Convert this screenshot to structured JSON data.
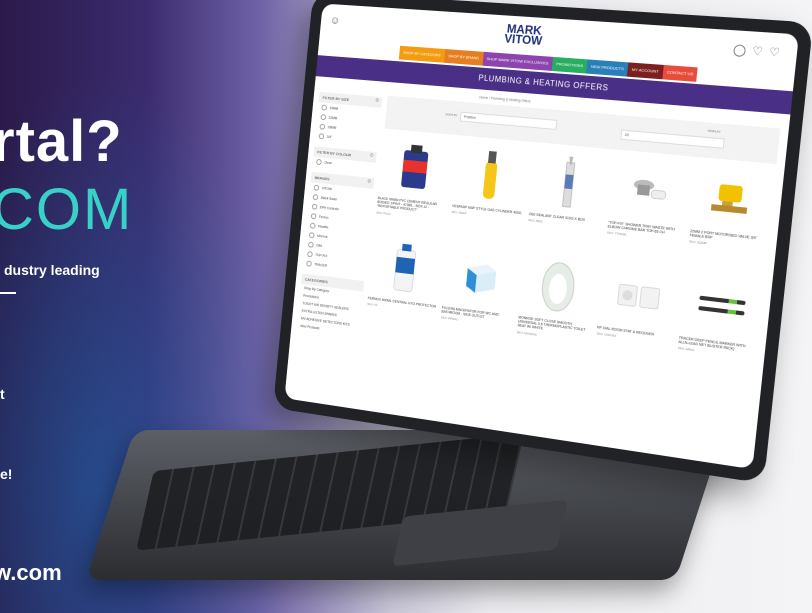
{
  "promo": {
    "line1": "rtal?",
    "line2": "COM",
    "line3": "dustry leading",
    "line4": "t",
    "line5": "e!",
    "url": "w.com"
  },
  "site": {
    "logo_top": "MARK",
    "logo_bottom": "VITOW",
    "nav": [
      {
        "label": "SHOP BY CATEGORY",
        "color": "#f39c12"
      },
      {
        "label": "SHOP BY BRAND",
        "color": "#e67e22"
      },
      {
        "label": "SHOP MARK VITOW EXCLUSIVES",
        "color": "#8e44ad"
      },
      {
        "label": "PROMOTIONS",
        "color": "#27ae60"
      },
      {
        "label": "NEW PRODUCTS",
        "color": "#2980b9"
      },
      {
        "label": "MY ACCOUNT",
        "color": "#7b1f1f"
      },
      {
        "label": "CONTACT US",
        "color": "#e74c3c"
      }
    ],
    "banner": "PLUMBING & HEATING OFFERS",
    "breadcrumb": "Home  /  Plumbing & Heating Offers"
  },
  "sidebar": {
    "size_title": "FILTER BY SIZE",
    "sizes": [
      "15MM",
      "22MM",
      "28MM",
      "3/4\""
    ],
    "colour_title": "FILTER BY COLOUR",
    "colours": [
      "Clear"
    ],
    "brands_title": "BRANDS",
    "brands": [
      "VITOW",
      "Black Swan",
      "EPH Controls",
      "Fernox",
      "Flowflix",
      "Monroe",
      "OBJ",
      "TOP-FIX",
      "TRACER"
    ],
    "categories_title": "CATEGORIES",
    "categories": [
      "Shop By Category",
      "Promotions",
      "TOILET AIR DENSITY SEALERS",
      "EXTRA LISTEN SPARES",
      "MV ADHESIVE DETECTORS KITS",
      "New Products"
    ]
  },
  "filters": {
    "sort_label": "SORT BY",
    "sort_value": "Position",
    "display_label": "DISPLAY",
    "display_value": "20"
  },
  "products": [
    {
      "name": "BLACK SWAN PVC CEMENT REGULAR BODIED 1/PINT - 473ML - BOX 12 - \"REPORTABLE PRODUCT\"",
      "sku": "SKU: PVC4"
    },
    {
      "name": "VESPASP MAP STYLE GAS CYLINDER 400G",
      "sku": "SKU: 0MAP"
    },
    {
      "name": "OBJ SEALANT CLEAR 310G X BOX",
      "sku": "SKU: 0BJC"
    },
    {
      "name": "\"TOP-FIX\" SHOWER TRAY WASTE WITH ELBOW CHROME BAR TOP-65 CH",
      "sku": "SKU: TTW28C"
    },
    {
      "name": "22MM 2 PORT MOTORISED VALVE 3/4\" FEMALE BSP",
      "sku": "SKU: 022MP"
    },
    {
      "name": "FERNOX 500ML CENTRAL HTG PROTECTOR",
      "sku": "SKU: F1"
    },
    {
      "name": "FILLERA MACERATOR FOR WC AND BATHROOM - SIDE OUTLET",
      "sku": "SKU: PPMAC"
    },
    {
      "name": "MONROE SOFT CLOSE SMOOTH UNIVERSAL 3.6 THERMOPLASTIC TOILET SEAT W/ WHITE",
      "sku": "SKU: MVSMSC"
    },
    {
      "name": "RF DIAL ROOM STAT & RECEIVER",
      "sku": "SKU: CPAO63"
    },
    {
      "name": "TRACER DEEP PENCIL MARKER WITH ALLN-LEAD NET BLISTER PACK)",
      "sku": "SKU: ARM1"
    }
  ]
}
